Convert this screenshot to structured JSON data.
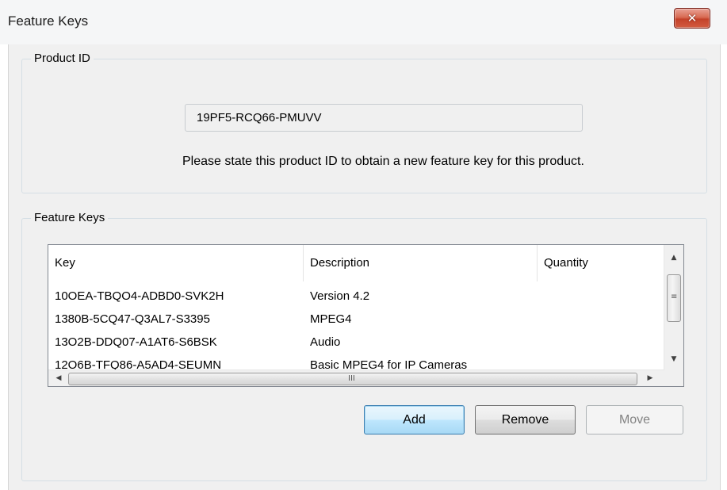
{
  "window": {
    "title": "Feature Keys",
    "close_glyph": "✕"
  },
  "product_id_group": {
    "label": "Product ID",
    "product_id": "19PF5-RCQ66-PMUVV",
    "hint": "Please state this product ID to obtain a new feature key for this product."
  },
  "feature_keys_group": {
    "label": "Feature Keys",
    "columns": [
      "Key",
      "Description",
      "Quantity"
    ],
    "rows": [
      {
        "key": "10OEA-TBQO4-ADBD0-SVK2H",
        "description": "Version 4.2",
        "quantity": ""
      },
      {
        "key": "1380B-5CQ47-Q3AL7-S3395",
        "description": "MPEG4",
        "quantity": ""
      },
      {
        "key": "13O2B-DDQ07-A1AT6-S6BSK",
        "description": "Audio",
        "quantity": ""
      },
      {
        "key": "12O6B-TFQ86-A5AD4-SEUMN",
        "description": "Basic MPEG4 for IP Cameras",
        "quantity": ""
      }
    ],
    "scroll": {
      "up_icon": "▲",
      "down_icon": "▼",
      "left_icon": "◀",
      "right_icon": "▶",
      "hgrip": "III",
      "vgrip": "≡"
    }
  },
  "buttons": {
    "add": "Add",
    "remove": "Remove",
    "move": "Move"
  }
}
